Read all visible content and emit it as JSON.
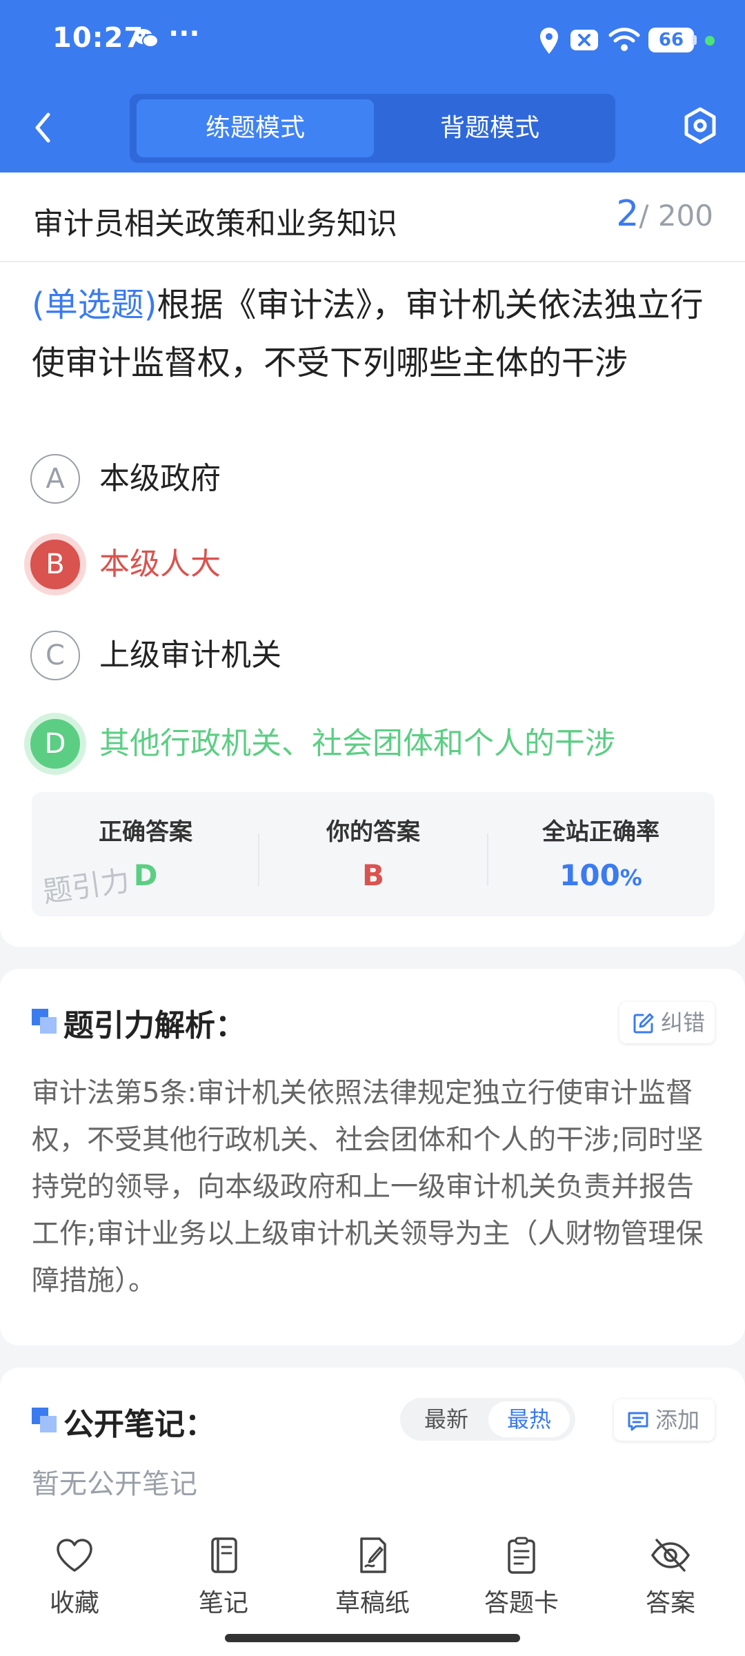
{
  "status_bar": {
    "time": "10:27",
    "more": "···",
    "battery": "66"
  },
  "nav": {
    "back_icon": "chevron-left-icon",
    "mode_tabs": [
      {
        "label": "练题模式",
        "active": true
      },
      {
        "label": "背题模式",
        "active": false
      }
    ],
    "settings_icon": "hexagon-settings-icon"
  },
  "question": {
    "subject": "审计员相关政策和业务知识",
    "index": "2",
    "total": "/ 200",
    "type": "(单选题)",
    "text": "根据《审计法》，审计机关依法独立行使审计监督权，不受下列哪些主体的干涉",
    "options": [
      {
        "letter": "A",
        "text": "本级政府",
        "state": "normal"
      },
      {
        "letter": "B",
        "text": "本级人大",
        "state": "wrong"
      },
      {
        "letter": "C",
        "text": "上级审计机关",
        "state": "normal"
      },
      {
        "letter": "D",
        "text": "其他行政机关、社会团体和个人的干涉",
        "state": "correct"
      }
    ]
  },
  "answer_summary": {
    "correct_label": "正确答案",
    "correct_value": "D",
    "yours_label": "你的答案",
    "yours_value": "B",
    "rate_label": "全站正确率",
    "rate_value": "100",
    "rate_unit": "%",
    "watermark": "题引力",
    "colors": {
      "correct": "#5cce84",
      "wrong": "#d9534f",
      "accent": "#3b7bf0"
    }
  },
  "analysis": {
    "title": "题引力解析：",
    "report_label": "纠错",
    "text": "审计法第5条:审计机关依照法律规定独立行使审计监督权，不受其他行政机关、社会团体和个人的干涉;同时坚持党的领导，向本级政府和上一级审计机关负责并报告工作;审计业务以上级审计机关领导为主（人财物管理保障措施）。"
  },
  "notes": {
    "title": "公开笔记：",
    "sort_options": [
      "最新",
      "最热"
    ],
    "sort_selected": "最热",
    "add_label": "添加",
    "empty_text": "暂无公开笔记"
  },
  "toolbar": [
    {
      "label": "收藏",
      "icon": "heart-icon"
    },
    {
      "label": "笔记",
      "icon": "notebook-icon"
    },
    {
      "label": "草稿纸",
      "icon": "draft-paper-icon"
    },
    {
      "label": "答题卡",
      "icon": "answer-sheet-icon"
    },
    {
      "label": "答案",
      "icon": "eye-off-icon"
    }
  ]
}
